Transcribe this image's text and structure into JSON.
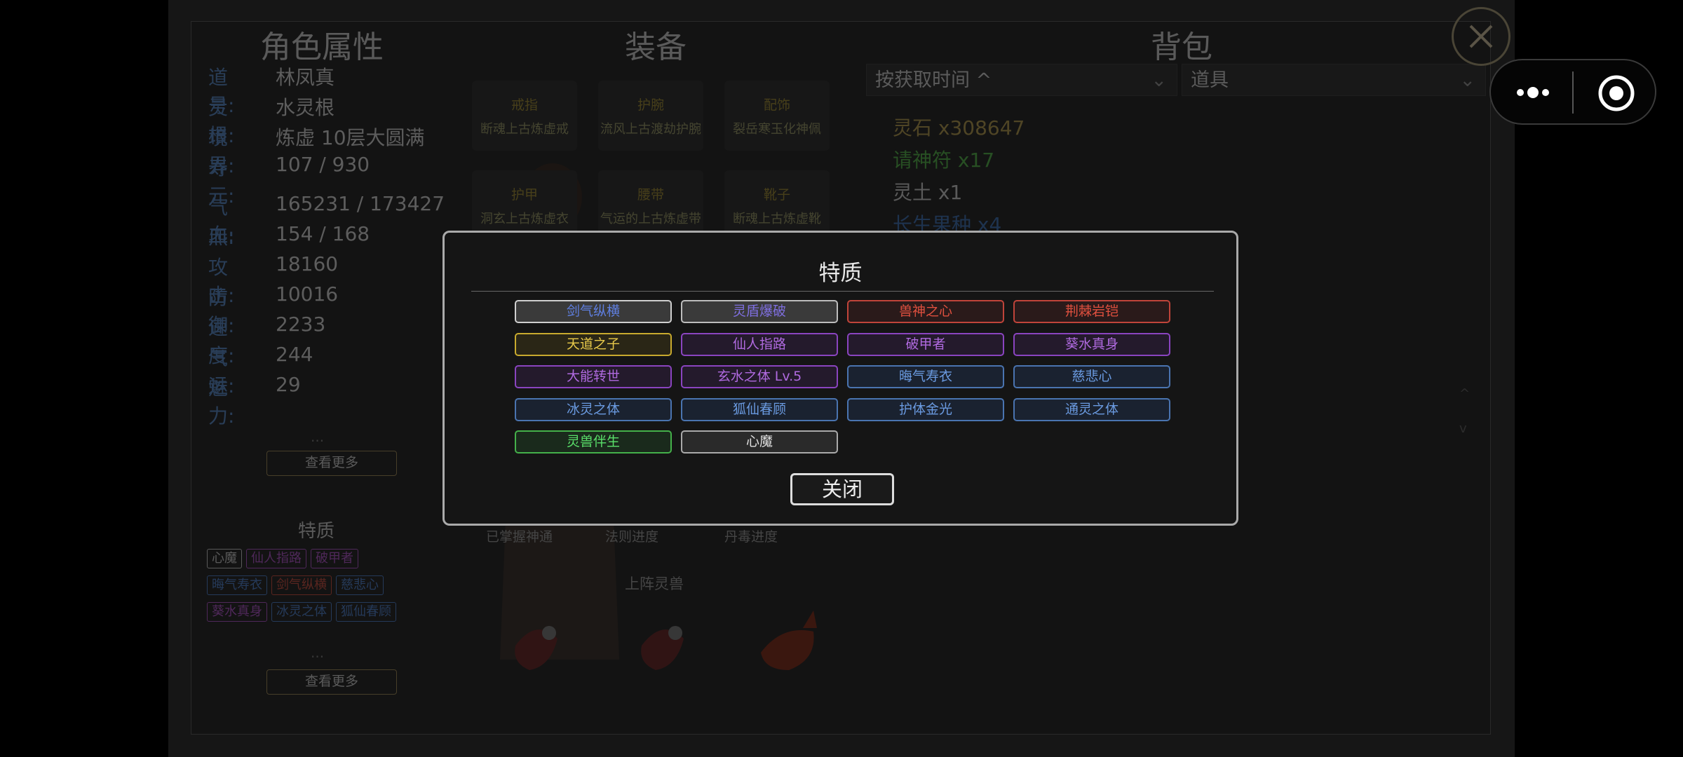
{
  "character": {
    "title": "角色属性",
    "rows": [
      {
        "label": "道号:",
        "value": "林凤真"
      },
      {
        "label": "灵根:",
        "value": "水灵根"
      },
      {
        "label": "境界:",
        "value": "炼虚 10层大圆满"
      },
      {
        "label": "寿元:",
        "value": "107 / 930"
      },
      {
        "label": "气血:",
        "value": "165231 / 173427"
      },
      {
        "label": "炁:",
        "value": "154 / 168"
      },
      {
        "label": "攻击:",
        "value": "18160"
      },
      {
        "label": "防御:",
        "value": "10016"
      },
      {
        "label": "速度:",
        "value": "2233"
      },
      {
        "label": "气运:",
        "value": "244"
      },
      {
        "label": "魅力:",
        "value": "29"
      }
    ],
    "ellipsis": "...",
    "view_more": "查看更多",
    "traits_title": "特质",
    "traits_mini": [
      "心魔",
      "仙人指路",
      "破甲者",
      "晦气寿衣",
      "剑气纵横",
      "慈悲心",
      "葵水真身",
      "冰灵之体",
      "狐仙春顾"
    ],
    "view_more_2": "查看更多"
  },
  "equipment": {
    "title": "装备",
    "slots": [
      {
        "name": "戒指",
        "item": "断魂上古炼虚戒"
      },
      {
        "name": "护腕",
        "item": "流风上古渡劫护腕"
      },
      {
        "name": "配饰",
        "item": "裂岳寒玉化神佩"
      },
      {
        "name": "护甲",
        "item": "洞玄上古炼虚衣"
      },
      {
        "name": "腰带",
        "item": "气运的上古炼虚带"
      },
      {
        "name": "靴子",
        "item": "断魂上古炼虚靴"
      }
    ],
    "progress": [
      "已掌握神通",
      "法则进度",
      "丹毒进度"
    ],
    "pets_title": "上阵灵兽"
  },
  "bag": {
    "title": "背包",
    "sort_select": "按获取时间 ^",
    "type_select": "道具",
    "items": [
      {
        "text": "灵石 x308647",
        "color": "#7a6a3a"
      },
      {
        "text": "请神符 x17",
        "color": "#3d7a36"
      },
      {
        "text": "灵土 x1",
        "color": "#8a8a8a"
      },
      {
        "text": "长生果种 x4",
        "color": "#2f4f7a"
      }
    ],
    "scroll_up": "^",
    "scroll_down": "v"
  },
  "modal": {
    "title": "特质",
    "traits": [
      {
        "label": "剑气纵横",
        "text": "#5f7fe0",
        "border": "#cfcfcf",
        "bg": "#3a3a3a"
      },
      {
        "label": "灵盾爆破",
        "text": "#7f6fe0",
        "border": "#bdbdbd",
        "bg": "#3a3a3a"
      },
      {
        "label": "兽神之心",
        "text": "#e0503f",
        "border": "#c0443a",
        "bg": "#2a1a1a"
      },
      {
        "label": "荆棘岩铠",
        "text": "#e0503f",
        "border": "#c0443a",
        "bg": "#2a1a1a"
      },
      {
        "label": "天道之子",
        "text": "#e8c94a",
        "border": "#c8aa2e",
        "bg": "#2a2616"
      },
      {
        "label": "仙人指路",
        "text": "#b06ae0",
        "border": "#8a44c0",
        "bg": "#241a2c"
      },
      {
        "label": "破甲者",
        "text": "#b06ae0",
        "border": "#8a44c0",
        "bg": "#241a2c"
      },
      {
        "label": "葵水真身",
        "text": "#b06ae0",
        "border": "#8a44c0",
        "bg": "#241a2c"
      },
      {
        "label": "大能转世",
        "text": "#b06ae0",
        "border": "#8a44c0",
        "bg": "#241a2c"
      },
      {
        "label": "玄水之体 Lv.5",
        "text": "#b06ae0",
        "border": "#8a44c0",
        "bg": "#241a2c"
      },
      {
        "label": "晦气寿衣",
        "text": "#6a9ae0",
        "border": "#4a74b0",
        "bg": "#1a2230"
      },
      {
        "label": "慈悲心",
        "text": "#6a9ae0",
        "border": "#4a74b0",
        "bg": "#1a2230"
      },
      {
        "label": "冰灵之体",
        "text": "#6a9ae0",
        "border": "#4a74b0",
        "bg": "#1a2230"
      },
      {
        "label": "狐仙春顾",
        "text": "#6a9ae0",
        "border": "#4a74b0",
        "bg": "#1a2230"
      },
      {
        "label": "护体金光",
        "text": "#6a9ae0",
        "border": "#4a74b0",
        "bg": "#1a2230"
      },
      {
        "label": "通灵之体",
        "text": "#6a9ae0",
        "border": "#4a74b0",
        "bg": "#1a2230"
      },
      {
        "label": "灵兽伴生",
        "text": "#5ae06a",
        "border": "#44b04a",
        "bg": "#1a2a1c"
      },
      {
        "label": "心魔",
        "text": "#e0e0e0",
        "border": "#aaaaaa",
        "bg": "#2a2a2a"
      }
    ],
    "close_label": "关闭"
  }
}
